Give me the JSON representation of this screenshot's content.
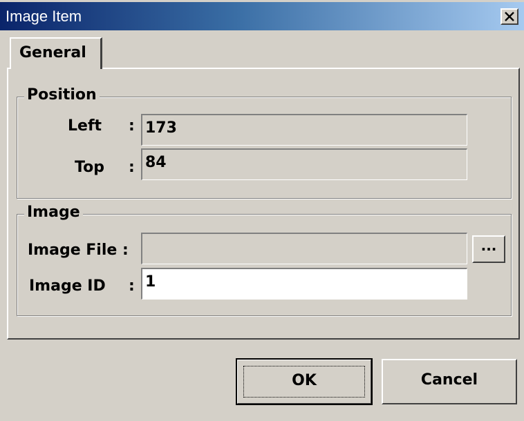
{
  "window": {
    "title": "Image Item",
    "close_glyph": "✕"
  },
  "tabs": [
    {
      "label": "General"
    }
  ],
  "position_group": {
    "title": "Position",
    "left_label": "Left",
    "left_value": "173",
    "top_label": "Top",
    "top_value": "84",
    "colon": ":"
  },
  "image_group": {
    "title": "Image",
    "file_label": "Image File :",
    "file_value": "",
    "browse_label": "...",
    "id_label": "Image ID",
    "id_value": "1",
    "colon": ":"
  },
  "buttons": {
    "ok": "OK",
    "cancel": "Cancel"
  },
  "colors": {
    "titlebar_start": "#0a246a",
    "titlebar_end": "#a6caf0",
    "face": "#d4d0c8"
  }
}
